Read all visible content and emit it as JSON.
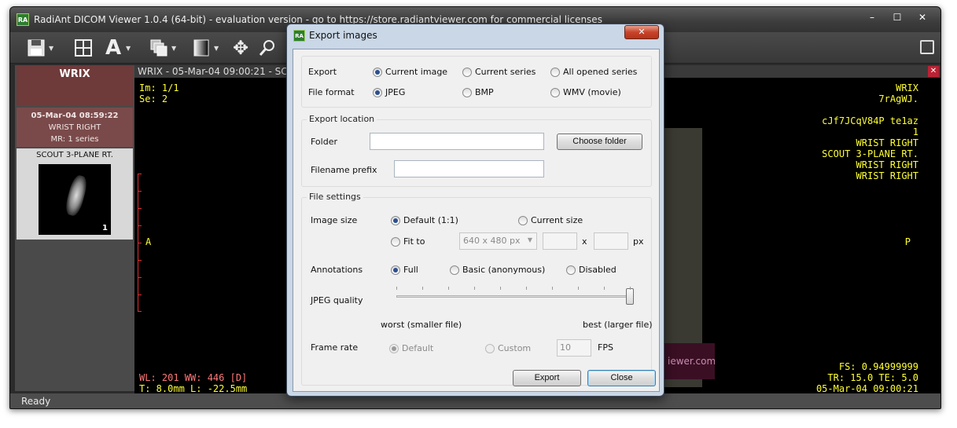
{
  "main_window": {
    "title": "RadiAnt DICOM Viewer 1.0.4 (64-bit) - evaluation version - go to https://store.radiantviewer.com for commercial licenses",
    "app_icon_text": "RA",
    "minimize": "–",
    "maximize": "☐",
    "close": "✕"
  },
  "toolbar": {
    "save_icon": "save-icon",
    "layout_icon": "layout-grid-icon",
    "annotation_icon": "text-annotation-icon",
    "annotation_glyph": "A",
    "series_icon": "series-stack-icon",
    "window_level_icon": "window-level-icon",
    "pan_icon": "pan-icon",
    "pan_glyph": "✥",
    "zoom_icon": "zoom-icon",
    "dropdown_glyph": "▼",
    "fullscreen_icon": "fullscreen-icon"
  },
  "left_panel": {
    "patient_name": "WRIX",
    "study_datetime": "05-Mar-04 08:59:22",
    "study_desc": "WRIST RIGHT",
    "study_modality": "MR: 1 series",
    "series_name": "SCOUT 3-PLANE RT.",
    "series_count": "1"
  },
  "viewer": {
    "header": "WRIX - 05-Mar-04 09:00:21 - SC",
    "close": "✕",
    "top_left": [
      "Im: 1/1",
      "Se: 2"
    ],
    "top_right": [
      "WRIX",
      "7rAgWJ.",
      "",
      "cJf7JCqV84P te1az",
      "1",
      "WRIST RIGHT",
      "SCOUT 3-PLANE RT.",
      "WRIST RIGHT",
      "WRIST RIGHT"
    ],
    "orientation_left": "A",
    "orientation_right": "P",
    "bottom_left_wl": "WL: 201 WW: 446 [D]",
    "bottom_left_t": "T: 8.0mm L: -22.5mm",
    "bottom_right": [
      "FS: 0.94999999",
      "TR: 15.0 TE: 5.0",
      "05-Mar-04 09:00:21"
    ],
    "watermark_text": "iewer.com"
  },
  "status": "Ready",
  "dialog": {
    "title": "Export images",
    "icon_text": "RA",
    "close": "✕",
    "export_label": "Export",
    "export_options": [
      "Current image",
      "Current series",
      "All opened series"
    ],
    "file_format_label": "File format",
    "format_options": [
      "JPEG",
      "BMP",
      "WMV (movie)"
    ],
    "location_group": "Export location",
    "folder_label": "Folder",
    "folder_value": "",
    "choose_folder": "Choose folder",
    "prefix_label": "Filename prefix",
    "prefix_value": "",
    "settings_group": "File settings",
    "image_size_label": "Image size",
    "size_default": "Default (1:1)",
    "size_current": "Current size",
    "size_fit": "Fit to",
    "fit_preset": "640 x 480 px",
    "fit_x": "x",
    "fit_unit": "px",
    "annotations_label": "Annotations",
    "ann_options": [
      "Full",
      "Basic (anonymous)",
      "Disabled"
    ],
    "jpeg_quality_label": "JPEG quality",
    "jpeg_quality_value": 1.0,
    "quality_worst": "worst (smaller file)",
    "quality_best": "best (larger file)",
    "frame_rate_label": "Frame rate",
    "fr_default": "Default",
    "fr_custom": "Custom",
    "fps_value": "10",
    "fps_unit": "FPS",
    "export_btn": "Export",
    "close_btn": "Close"
  }
}
